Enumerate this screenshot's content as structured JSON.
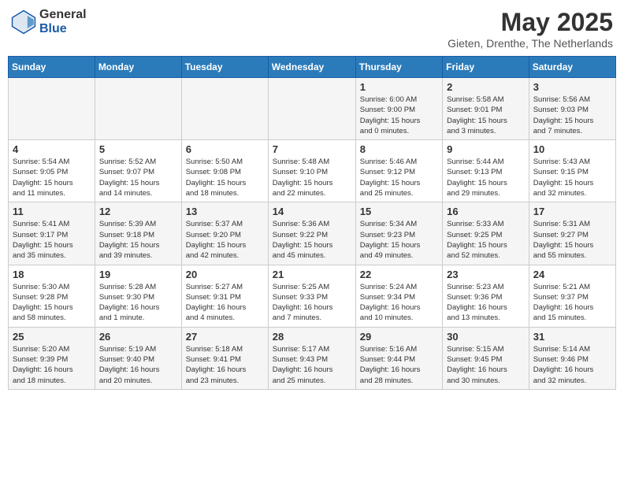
{
  "header": {
    "logo_general": "General",
    "logo_blue": "Blue",
    "title": "May 2025",
    "subtitle": "Gieten, Drenthe, The Netherlands"
  },
  "days_of_week": [
    "Sunday",
    "Monday",
    "Tuesday",
    "Wednesday",
    "Thursday",
    "Friday",
    "Saturday"
  ],
  "weeks": [
    [
      {
        "day": "",
        "info": ""
      },
      {
        "day": "",
        "info": ""
      },
      {
        "day": "",
        "info": ""
      },
      {
        "day": "",
        "info": ""
      },
      {
        "day": "1",
        "info": "Sunrise: 6:00 AM\nSunset: 9:00 PM\nDaylight: 15 hours\nand 0 minutes."
      },
      {
        "day": "2",
        "info": "Sunrise: 5:58 AM\nSunset: 9:01 PM\nDaylight: 15 hours\nand 3 minutes."
      },
      {
        "day": "3",
        "info": "Sunrise: 5:56 AM\nSunset: 9:03 PM\nDaylight: 15 hours\nand 7 minutes."
      }
    ],
    [
      {
        "day": "4",
        "info": "Sunrise: 5:54 AM\nSunset: 9:05 PM\nDaylight: 15 hours\nand 11 minutes."
      },
      {
        "day": "5",
        "info": "Sunrise: 5:52 AM\nSunset: 9:07 PM\nDaylight: 15 hours\nand 14 minutes."
      },
      {
        "day": "6",
        "info": "Sunrise: 5:50 AM\nSunset: 9:08 PM\nDaylight: 15 hours\nand 18 minutes."
      },
      {
        "day": "7",
        "info": "Sunrise: 5:48 AM\nSunset: 9:10 PM\nDaylight: 15 hours\nand 22 minutes."
      },
      {
        "day": "8",
        "info": "Sunrise: 5:46 AM\nSunset: 9:12 PM\nDaylight: 15 hours\nand 25 minutes."
      },
      {
        "day": "9",
        "info": "Sunrise: 5:44 AM\nSunset: 9:13 PM\nDaylight: 15 hours\nand 29 minutes."
      },
      {
        "day": "10",
        "info": "Sunrise: 5:43 AM\nSunset: 9:15 PM\nDaylight: 15 hours\nand 32 minutes."
      }
    ],
    [
      {
        "day": "11",
        "info": "Sunrise: 5:41 AM\nSunset: 9:17 PM\nDaylight: 15 hours\nand 35 minutes."
      },
      {
        "day": "12",
        "info": "Sunrise: 5:39 AM\nSunset: 9:18 PM\nDaylight: 15 hours\nand 39 minutes."
      },
      {
        "day": "13",
        "info": "Sunrise: 5:37 AM\nSunset: 9:20 PM\nDaylight: 15 hours\nand 42 minutes."
      },
      {
        "day": "14",
        "info": "Sunrise: 5:36 AM\nSunset: 9:22 PM\nDaylight: 15 hours\nand 45 minutes."
      },
      {
        "day": "15",
        "info": "Sunrise: 5:34 AM\nSunset: 9:23 PM\nDaylight: 15 hours\nand 49 minutes."
      },
      {
        "day": "16",
        "info": "Sunrise: 5:33 AM\nSunset: 9:25 PM\nDaylight: 15 hours\nand 52 minutes."
      },
      {
        "day": "17",
        "info": "Sunrise: 5:31 AM\nSunset: 9:27 PM\nDaylight: 15 hours\nand 55 minutes."
      }
    ],
    [
      {
        "day": "18",
        "info": "Sunrise: 5:30 AM\nSunset: 9:28 PM\nDaylight: 15 hours\nand 58 minutes."
      },
      {
        "day": "19",
        "info": "Sunrise: 5:28 AM\nSunset: 9:30 PM\nDaylight: 16 hours\nand 1 minute."
      },
      {
        "day": "20",
        "info": "Sunrise: 5:27 AM\nSunset: 9:31 PM\nDaylight: 16 hours\nand 4 minutes."
      },
      {
        "day": "21",
        "info": "Sunrise: 5:25 AM\nSunset: 9:33 PM\nDaylight: 16 hours\nand 7 minutes."
      },
      {
        "day": "22",
        "info": "Sunrise: 5:24 AM\nSunset: 9:34 PM\nDaylight: 16 hours\nand 10 minutes."
      },
      {
        "day": "23",
        "info": "Sunrise: 5:23 AM\nSunset: 9:36 PM\nDaylight: 16 hours\nand 13 minutes."
      },
      {
        "day": "24",
        "info": "Sunrise: 5:21 AM\nSunset: 9:37 PM\nDaylight: 16 hours\nand 15 minutes."
      }
    ],
    [
      {
        "day": "25",
        "info": "Sunrise: 5:20 AM\nSunset: 9:39 PM\nDaylight: 16 hours\nand 18 minutes."
      },
      {
        "day": "26",
        "info": "Sunrise: 5:19 AM\nSunset: 9:40 PM\nDaylight: 16 hours\nand 20 minutes."
      },
      {
        "day": "27",
        "info": "Sunrise: 5:18 AM\nSunset: 9:41 PM\nDaylight: 16 hours\nand 23 minutes."
      },
      {
        "day": "28",
        "info": "Sunrise: 5:17 AM\nSunset: 9:43 PM\nDaylight: 16 hours\nand 25 minutes."
      },
      {
        "day": "29",
        "info": "Sunrise: 5:16 AM\nSunset: 9:44 PM\nDaylight: 16 hours\nand 28 minutes."
      },
      {
        "day": "30",
        "info": "Sunrise: 5:15 AM\nSunset: 9:45 PM\nDaylight: 16 hours\nand 30 minutes."
      },
      {
        "day": "31",
        "info": "Sunrise: 5:14 AM\nSunset: 9:46 PM\nDaylight: 16 hours\nand 32 minutes."
      }
    ]
  ]
}
